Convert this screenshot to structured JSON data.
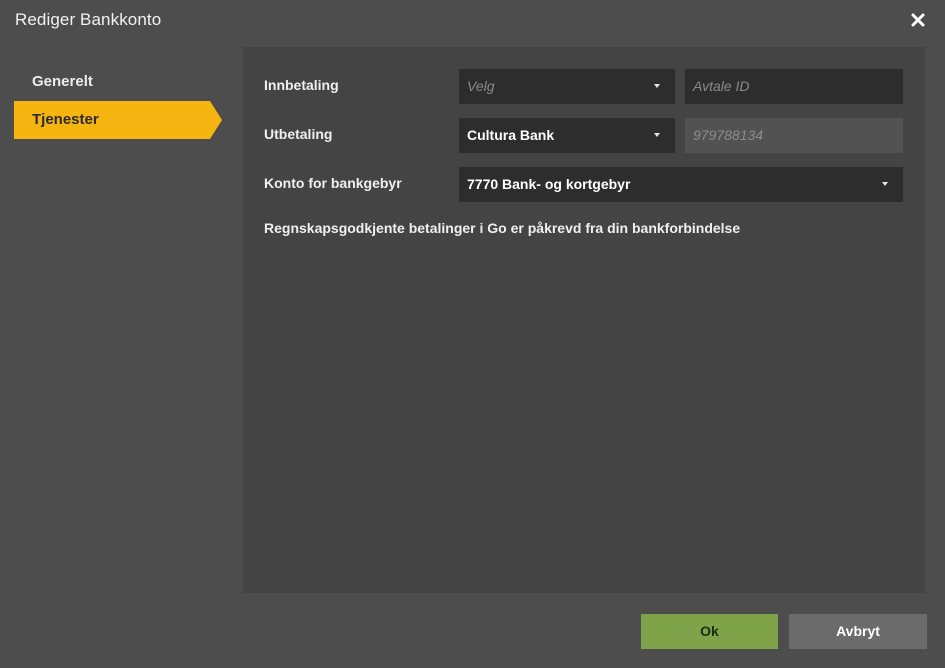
{
  "dialog": {
    "title": "Rediger Bankkonto",
    "close_icon": "close-icon"
  },
  "sidebar": {
    "items": [
      {
        "label": "Generelt",
        "active": false
      },
      {
        "label": "Tjenester",
        "active": true
      }
    ],
    "active_color": "#f5b40f"
  },
  "form": {
    "innbetaling": {
      "label": "Innbetaling",
      "select_placeholder": "Velg",
      "agreement_placeholder": "Avtale ID"
    },
    "utbetaling": {
      "label": "Utbetaling",
      "select_value": "Cultura Bank",
      "agreement_value": "979788134"
    },
    "konto_bankgebyr": {
      "label": "Konto for bankgebyr",
      "select_value": "7770 Bank- og kortgebyr"
    },
    "info_text": "Regnskapsgodkjente betalinger i Go er påkrevd fra din bankforbindelse"
  },
  "footer": {
    "ok_label": "Ok",
    "cancel_label": "Avbryt",
    "ok_color": "#7ea349",
    "cancel_color": "#6b6b6b"
  }
}
